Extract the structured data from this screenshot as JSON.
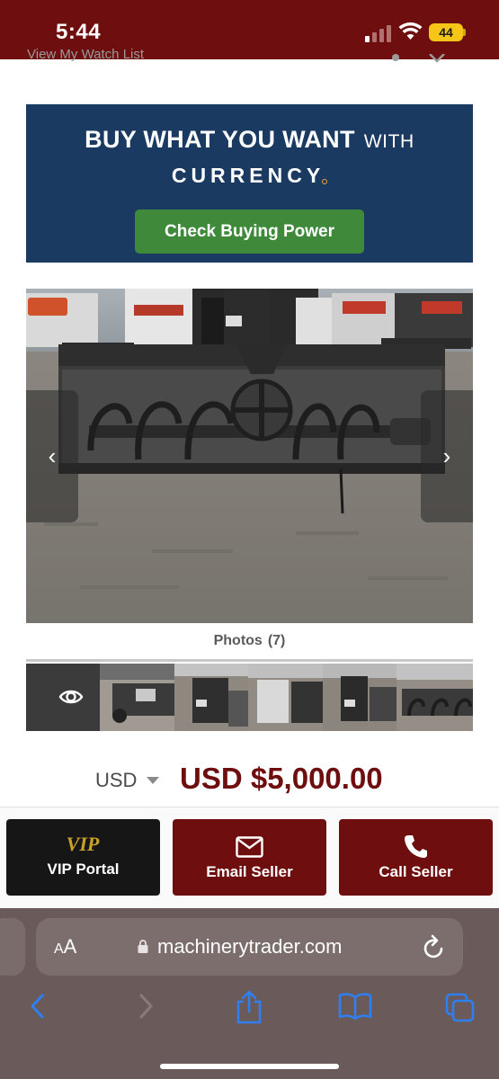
{
  "status_bar": {
    "time": "5:44",
    "battery": "44"
  },
  "header_cutoff": {
    "text": "View My Watch List"
  },
  "ad_banner": {
    "headline": "BUY WHAT YOU WANT",
    "headline_suffix": "WITH",
    "brand": "CURRENCY",
    "cta": "Check Buying Power"
  },
  "gallery": {
    "prev_icon": "chevron-left-icon",
    "next_icon": "chevron-right-icon",
    "photos_label": "Photos",
    "photos_count": "(7)",
    "view_icon": "eye-icon"
  },
  "price": {
    "currency": "USD",
    "amount": "USD $5,000.00"
  },
  "actions": {
    "vip_logo": "VIP",
    "vip_label": "VIP Portal",
    "email_label": "Email Seller",
    "call_label": "Call Seller"
  },
  "browser": {
    "text_size": "AA",
    "url": "machinerytrader.com"
  },
  "colors": {
    "brand_maroon": "#6e0e0e",
    "ad_navy": "#1a3a61",
    "ad_green": "#3e8a3a",
    "vip_gold": "#c9a227",
    "toolbar_blue": "#2f7ff0"
  }
}
